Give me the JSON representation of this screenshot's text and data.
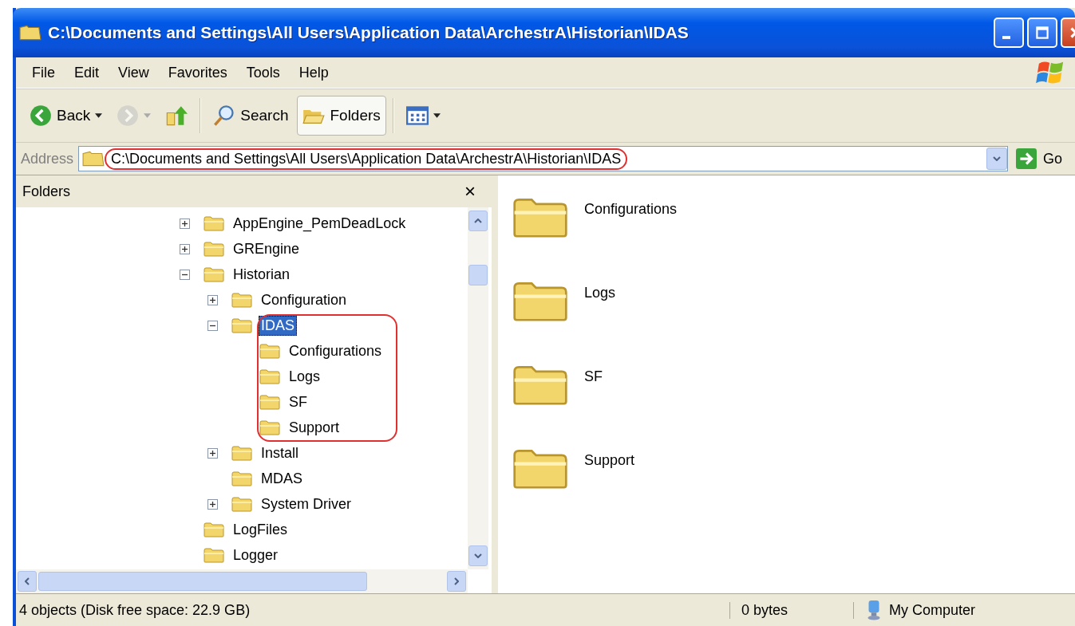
{
  "window": {
    "title": "C:\\Documents and Settings\\All Users\\Application Data\\ArchestrA\\Historian\\IDAS"
  },
  "menu": [
    "File",
    "Edit",
    "View",
    "Favorites",
    "Tools",
    "Help"
  ],
  "toolbar": [
    {
      "kind": "back",
      "label": "Back",
      "pressed": false,
      "disabled": false
    },
    {
      "kind": "forward",
      "pressed": false,
      "disabled": true
    },
    {
      "kind": "up",
      "pressed": false,
      "disabled": false
    },
    {
      "kind": "search",
      "label": "Search",
      "pressed": false,
      "disabled": false
    },
    {
      "kind": "folders",
      "label": "Folders",
      "pressed": true,
      "disabled": false
    },
    {
      "kind": "views",
      "pressed": false,
      "disabled": false
    }
  ],
  "address": {
    "label": "Address",
    "value": "C:\\Documents and Settings\\All Users\\Application Data\\ArchestrA\\Historian\\IDAS",
    "highlighted": true,
    "go_label": "Go"
  },
  "folders_pane": {
    "title": "Folders",
    "close": "×",
    "tree": [
      {
        "name": "AppEngine_PemDeadLock",
        "expanded": false,
        "selected": false,
        "highlighted": false
      },
      {
        "name": "GREngine",
        "expanded": false,
        "selected": false,
        "highlighted": false
      },
      {
        "name": "Historian",
        "expanded": true,
        "selected": false,
        "highlighted": false,
        "children": [
          {
            "name": "Configuration",
            "expanded": false,
            "selected": false,
            "highlighted": false
          },
          {
            "name": "IDAS",
            "expanded": true,
            "selected": true,
            "highlighted": true,
            "children": [
              {
                "name": "Configurations",
                "selected": false,
                "highlighted": false
              },
              {
                "name": "Logs",
                "selected": false,
                "highlighted": false
              },
              {
                "name": "SF",
                "selected": false,
                "highlighted": false
              },
              {
                "name": "Support",
                "selected": false,
                "highlighted": false
              }
            ]
          },
          {
            "name": "Install",
            "expanded": false,
            "selected": false,
            "highlighted": false
          },
          {
            "name": "MDAS",
            "selected": false,
            "highlighted": false
          },
          {
            "name": "System Driver",
            "expanded": false,
            "selected": false,
            "highlighted": false
          }
        ]
      },
      {
        "name": "LogFiles",
        "selected": false,
        "highlighted": false
      },
      {
        "name": "Logger",
        "selected": false,
        "highlighted": false
      }
    ]
  },
  "files": [
    {
      "name": "Configurations"
    },
    {
      "name": "Logs"
    },
    {
      "name": "SF"
    },
    {
      "name": "Support"
    }
  ],
  "status_bar": {
    "summary": "4 objects (Disk free space: 22.9 GB)",
    "size": "0 bytes",
    "zone": "My Computer"
  }
}
